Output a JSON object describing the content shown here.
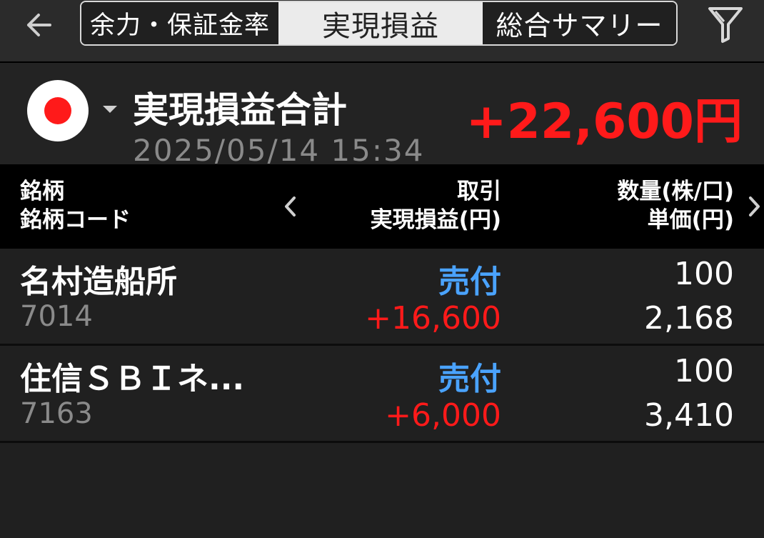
{
  "header": {
    "tabs": [
      {
        "label": "余力・保証金率"
      },
      {
        "label": "実現損益"
      },
      {
        "label": "総合サマリー"
      }
    ],
    "back_icon": "back-arrow-icon",
    "filter_icon": "filter-icon"
  },
  "summary": {
    "market_icon": "japan-flag-icon",
    "label": "実現損益合計",
    "datetime": "2025/05/14 15:34",
    "total": "+22,600円",
    "total_color": "#ff1a1a"
  },
  "table": {
    "headers": {
      "name_line1": "銘柄",
      "name_line2": "銘柄コード",
      "trade_line1": "取引",
      "trade_line2": "実現損益(円)",
      "qty_line1": "数量(株/口)",
      "qty_line2": "単価(円)"
    },
    "rows": [
      {
        "name": "名村造船所",
        "code": "7014",
        "side": "売付",
        "pl": "+16,600",
        "qty": "100",
        "price": "2,168"
      },
      {
        "name": "住信ＳＢＩネ...",
        "code": "7163",
        "side": "売付",
        "pl": "+6,000",
        "qty": "100",
        "price": "3,410"
      }
    ],
    "side_color": "#4aa3ff",
    "pl_color": "#ff1a1a"
  }
}
